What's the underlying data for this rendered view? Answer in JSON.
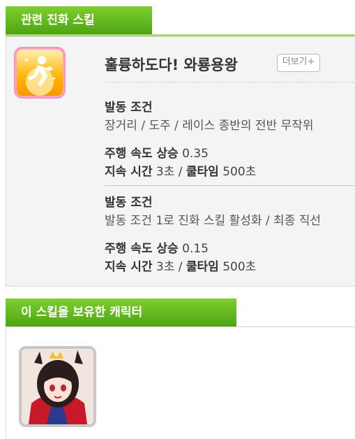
{
  "sections": {
    "related_title": "관련 진화 스킬",
    "owner_title": "이 스킬을 보유한 캐릭터"
  },
  "skill": {
    "icon": "running-figure-icon",
    "name": "훌륭하도다! 와룡용왕",
    "more_label": "더보기+",
    "effects": [
      {
        "condition_title": "발동 조건",
        "condition_text": "장거리 / 도주 / 레이스 종반의 전반 무작위",
        "speed_label": "주행 속도 상승",
        "speed_value": "0.35",
        "duration_label": "지속 시간",
        "duration_value": "3초",
        "separator": "/",
        "cooldown_label": "쿨타임",
        "cooldown_value": "500초"
      },
      {
        "condition_title": "발동 조건",
        "condition_text": "발동 조건 1로 진화 스킬 활성화 / 최종 직선",
        "speed_label": "주행 속도 상승",
        "speed_value": "0.15",
        "duration_label": "지속 시간",
        "duration_value": "3초",
        "separator": "/",
        "cooldown_label": "쿨타임",
        "cooldown_value": "500초"
      }
    ]
  },
  "character": {
    "icon": "character-portrait"
  },
  "colors": {
    "tab_green": "#5cb31e",
    "icon_orange": "#ffb300",
    "icon_border_pink": "#ff9fc4"
  }
}
